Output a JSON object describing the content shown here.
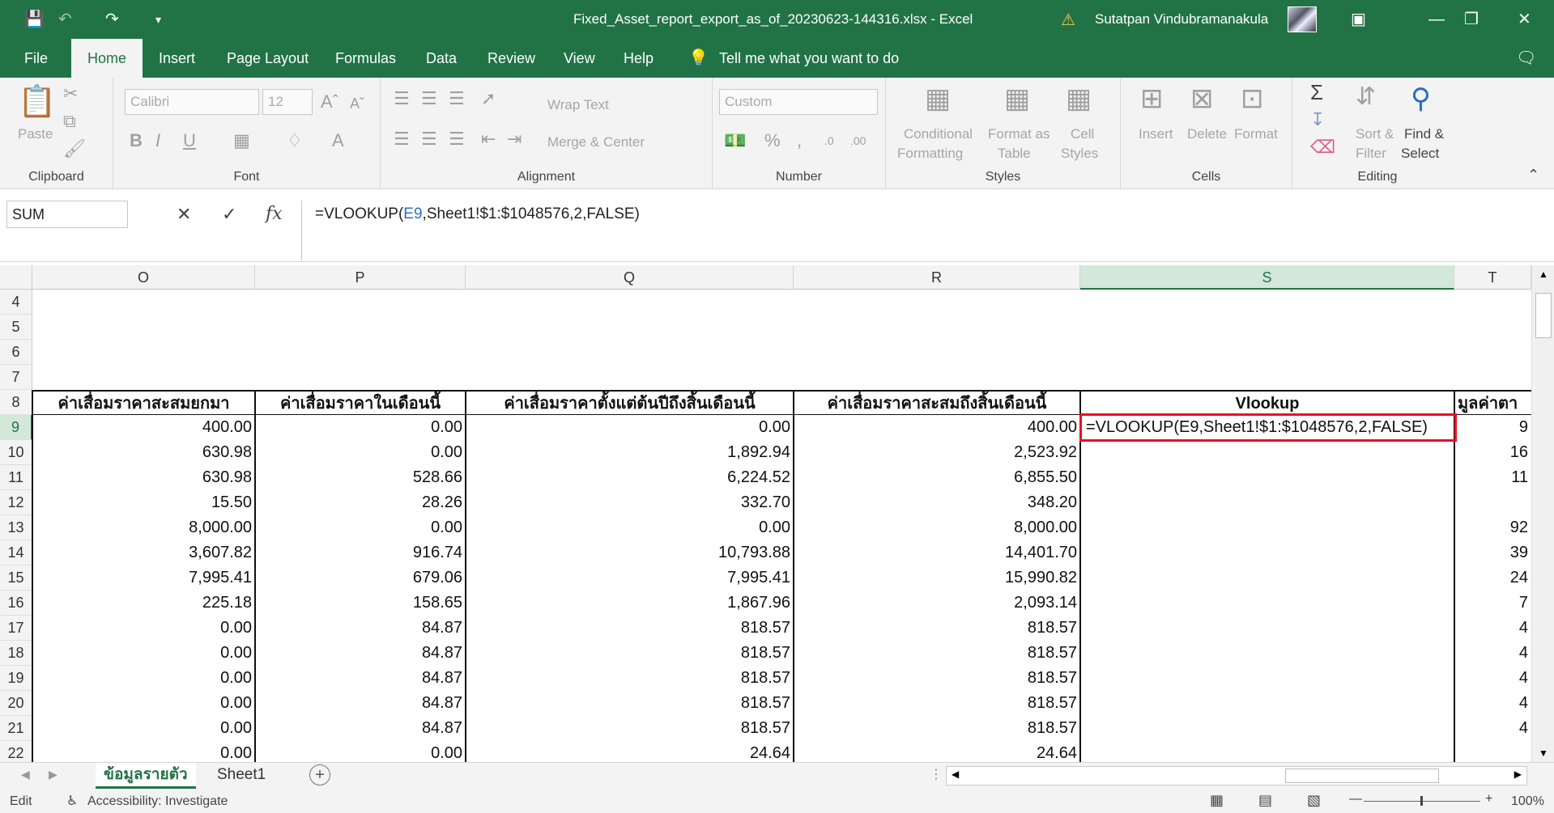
{
  "window": {
    "title": "Fixed_Asset_report_export_as_of_20230623-144316.xlsx  -  Excel",
    "user": "Sutatpan Vindubramanakula"
  },
  "menu": {
    "tabs": [
      "File",
      "Home",
      "Insert",
      "Page Layout",
      "Formulas",
      "Data",
      "Review",
      "View",
      "Help"
    ],
    "tell_me": "Tell me what you want to do"
  },
  "ribbon": {
    "clipboard": {
      "paste": "Paste",
      "label": "Clipboard"
    },
    "font": {
      "name": "Calibri",
      "size": "12",
      "label": "Font"
    },
    "alignment": {
      "wrap": "Wrap Text",
      "merge": "Merge & Center",
      "label": "Alignment"
    },
    "number": {
      "format": "Custom",
      "label": "Number"
    },
    "styles": {
      "conditional": "Conditional",
      "conditional2": "Formatting",
      "format_as": "Format as",
      "format_as2": "Table",
      "cell": "Cell",
      "cell2": "Styles",
      "label": "Styles"
    },
    "cells": {
      "insert": "Insert",
      "delete": "Delete",
      "format": "Format",
      "label": "Cells"
    },
    "editing": {
      "sort": "Sort &",
      "sort2": "Filter",
      "find": "Find &",
      "find2": "Select",
      "label": "Editing"
    }
  },
  "formula_bar": {
    "name_box": "SUM",
    "prefix": "=VLOOKUP(",
    "ref": "E9",
    "suffix": ",Sheet1!$1:$1048576,2,FALSE)"
  },
  "columns": [
    "O",
    "P",
    "Q",
    "R",
    "S",
    "T"
  ],
  "row_numbers": [
    "4",
    "5",
    "6",
    "7",
    "8",
    "9",
    "10",
    "11",
    "12",
    "13",
    "14",
    "15",
    "16",
    "17",
    "18",
    "19",
    "20",
    "21",
    "22"
  ],
  "headers": {
    "O": "ค่าเสื่อมราคาสะสมยกมา",
    "P": "ค่าเสื่อมราคาในเดือนนี้",
    "Q": "ค่าเสื่อมราคาตั้งแต่ต้นปีถึงสิ้นเดือนนี้",
    "R": "ค่าเสื่อมราคาสะสมถึงสิ้นเดือนนี้",
    "S": "Vlookup",
    "T": "มูลค่าตา"
  },
  "active_cell_text": "=VLOOKUP(E9,Sheet1!$1:$1048576,2,FALSE)",
  "rows": [
    {
      "O": "400.00",
      "P": "0.00",
      "Q": "0.00",
      "R": "400.00",
      "T": "9"
    },
    {
      "O": "630.98",
      "P": "0.00",
      "Q": "1,892.94",
      "R": "2,523.92",
      "T": "16"
    },
    {
      "O": "630.98",
      "P": "528.66",
      "Q": "6,224.52",
      "R": "6,855.50",
      "T": "11"
    },
    {
      "O": "15.50",
      "P": "28.26",
      "Q": "332.70",
      "R": "348.20",
      "T": ""
    },
    {
      "O": "8,000.00",
      "P": "0.00",
      "Q": "0.00",
      "R": "8,000.00",
      "T": "92"
    },
    {
      "O": "3,607.82",
      "P": "916.74",
      "Q": "10,793.88",
      "R": "14,401.70",
      "T": "39"
    },
    {
      "O": "7,995.41",
      "P": "679.06",
      "Q": "7,995.41",
      "R": "15,990.82",
      "T": "24"
    },
    {
      "O": "225.18",
      "P": "158.65",
      "Q": "1,867.96",
      "R": "2,093.14",
      "T": "7"
    },
    {
      "O": "0.00",
      "P": "84.87",
      "Q": "818.57",
      "R": "818.57",
      "T": "4"
    },
    {
      "O": "0.00",
      "P": "84.87",
      "Q": "818.57",
      "R": "818.57",
      "T": "4"
    },
    {
      "O": "0.00",
      "P": "84.87",
      "Q": "818.57",
      "R": "818.57",
      "T": "4"
    },
    {
      "O": "0.00",
      "P": "84.87",
      "Q": "818.57",
      "R": "818.57",
      "T": "4"
    },
    {
      "O": "0.00",
      "P": "84.87",
      "Q": "818.57",
      "R": "818.57",
      "T": "4"
    },
    {
      "O": "0.00",
      "P": "0.00",
      "Q": "24.64",
      "R": "24.64",
      "T": ""
    }
  ],
  "sheets": [
    "ข้อมูลรายตัว",
    "Sheet1"
  ],
  "status": {
    "mode": "Edit",
    "accessibility": "Accessibility: Investigate",
    "zoom": "100%"
  }
}
